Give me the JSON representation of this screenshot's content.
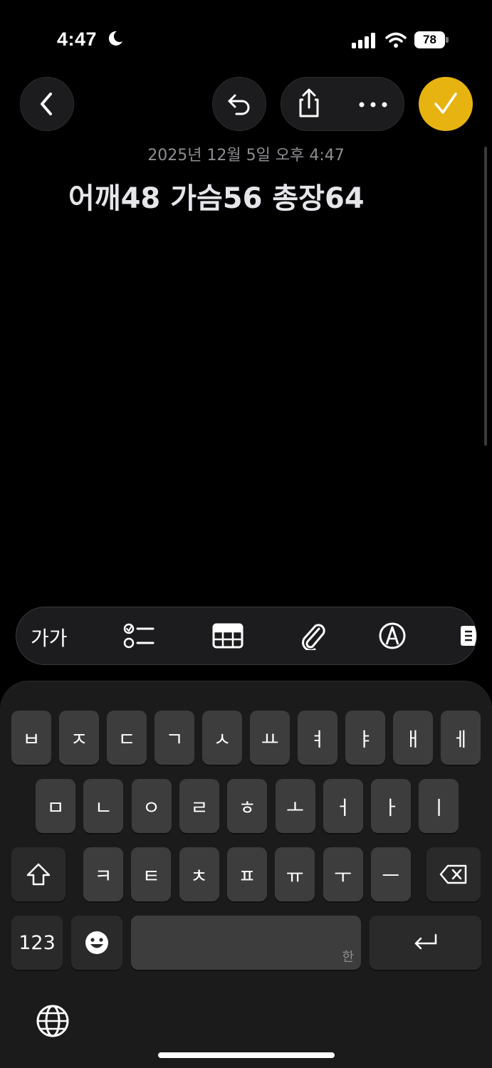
{
  "status_bar": {
    "time": "4:47",
    "battery": "78",
    "icons": [
      "moon-icon",
      "cellular-signal-icon",
      "wifi-icon",
      "battery-icon"
    ]
  },
  "toolbar": {
    "back_icon": "chevron-left-icon",
    "undo_icon": "undo-icon",
    "share_icon": "share-icon",
    "more_icon": "ellipsis-icon",
    "done_icon": "checkmark-icon",
    "accent": "#e6b310"
  },
  "note": {
    "date": "2025년 12월 5일 오후 4:47",
    "title": "어깨48 가슴56 총장64"
  },
  "format_bar": {
    "text_style_label": "가가",
    "icons": [
      "checklist-icon",
      "table-icon",
      "paperclip-icon",
      "markup-pen-icon",
      "more-tools-icon"
    ]
  },
  "keyboard": {
    "row1": [
      "ㅂ",
      "ㅈ",
      "ㄷ",
      "ㄱ",
      "ㅅ",
      "ㅛ",
      "ㅕ",
      "ㅑ",
      "ㅐ",
      "ㅔ"
    ],
    "row2": [
      "ㅁ",
      "ㄴ",
      "ㅇ",
      "ㄹ",
      "ㅎ",
      "ㅗ",
      "ㅓ",
      "ㅏ",
      "ㅣ"
    ],
    "row3": [
      "ㅋ",
      "ㅌ",
      "ㅊ",
      "ㅍ",
      "ㅠ",
      "ㅜ",
      "ㅡ"
    ],
    "numbers_label": "123",
    "space_lang_label": "한",
    "special_icons": [
      "shift-icon",
      "backspace-icon",
      "emoji-icon",
      "return-icon",
      "globe-icon"
    ]
  }
}
